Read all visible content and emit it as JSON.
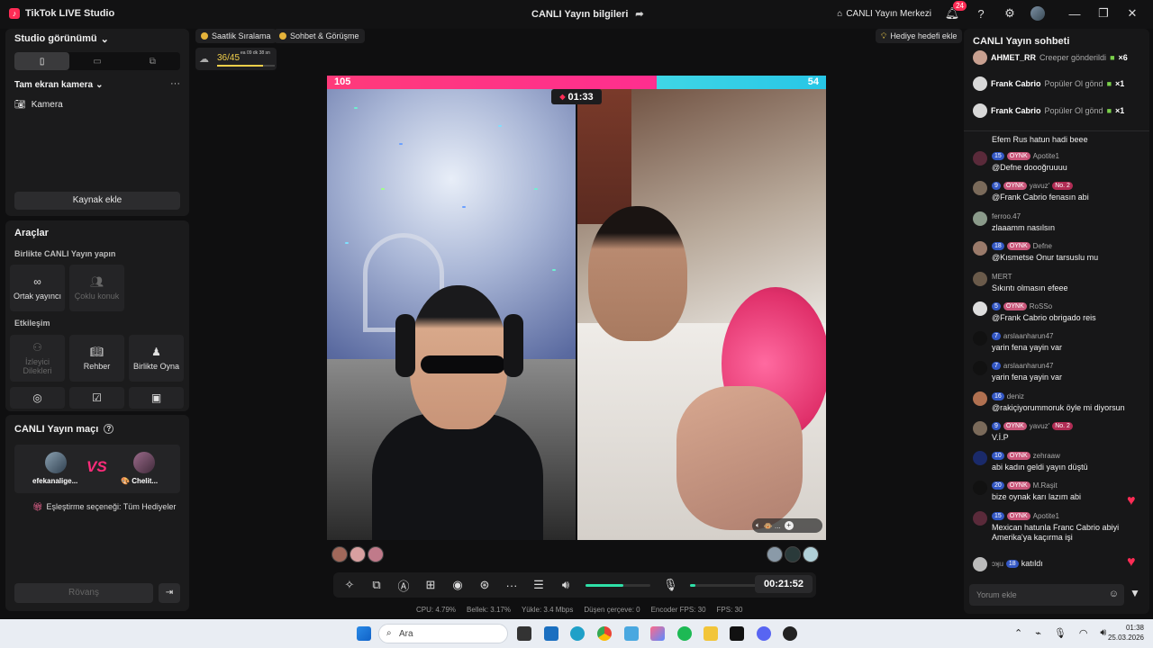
{
  "titlebar": {
    "app_name": "TikTok LIVE Studio",
    "live_info": "CANLI Yayın bilgileri",
    "live_center": "CANLI Yayın Merkezi",
    "notif_count": "24"
  },
  "left": {
    "studio_view": "Studio görünümü",
    "fullscreen_camera": "Tam ekran kamera",
    "camera": "Kamera",
    "add_source": "Kaynak ekle",
    "tools": "Araçlar",
    "live_together": "Birlikte CANLI Yayın yapın",
    "cohost": "Ortak yayıncı",
    "multi_guest": "Çoklu konuk",
    "interaction": "Etkileşim",
    "viewer_wishes": "İzleyici Dilekleri",
    "guide": "Rehber",
    "play_together": "Birlikte Oyna",
    "match_title": "CANLI Yayın maçı",
    "player1": "efekanalige...",
    "player2": "Chelit...",
    "vs": "VS",
    "match_option": "Eşleştirme seçeneği: Tüm Hediyeler",
    "rematch": "Rövanş"
  },
  "center": {
    "hourly_ranking": "Saatlik Sıralama",
    "chat_meet": "Sohbet & Görüşme",
    "goal_add": "Hediye hedefi ekle",
    "progress_text": "36/45",
    "progress_value": 0.8,
    "progress_sub": "ea 09 dk 38 sn",
    "score_left": "105",
    "score_right": "54",
    "battle_timer": "01:33",
    "live_time": "00:21:52"
  },
  "stats": {
    "cpu": "CPU: 4.79%",
    "memory": "Bellek: 3.17%",
    "upload": "Yükle: 3.4 Mbps",
    "dropped": "Düşen çerçeve: 0",
    "encoder_fps": "Encoder FPS: 30",
    "fps": "FPS: 30"
  },
  "chat": {
    "title": "CANLI Yayın sohbeti",
    "input_placeholder": "Yorum ekle",
    "gifts": [
      {
        "user": "AHMET_RR",
        "text": "Creeper gönderildi",
        "count": "×6"
      },
      {
        "user": "Frank Cabrio",
        "text": "Popüler Ol gönd",
        "count": "×1"
      },
      {
        "user": "Frank Cabrio",
        "text": "Popüler Ol gönd",
        "count": "×1"
      }
    ],
    "first_line": "Efem Rus hatun hadi beee",
    "messages": [
      {
        "lvl": "15",
        "tag": "OYNK",
        "user": "Apotite1",
        "text": "@Defne doooğruuuu",
        "color": "#5a2a3a"
      },
      {
        "lvl": "9",
        "tag": "OYNK",
        "user": "yavuz'",
        "extra": "No. 2",
        "text": "@Frank Cabrio fenasın abi",
        "color": "#7a6a5a"
      },
      {
        "lvl": "",
        "tag": "",
        "user": "ferroo.47",
        "text": "zlaaamm nasılsın",
        "color": "#8a9a8a"
      },
      {
        "lvl": "18",
        "tag": "OYNK",
        "user": "Defne",
        "text": "@Kısmetse Onur tarsuslu mu",
        "color": "#9a7a6a"
      },
      {
        "lvl": "",
        "tag": "",
        "user": "MERT",
        "text": "Sıkıntı olmasın efeee",
        "color": "#6a5a4a"
      },
      {
        "lvl": "5",
        "tag": "OYNK",
        "user": "RoSSo",
        "text": "@Frank Cabrio obrigado reis",
        "color": "#ddd"
      },
      {
        "lvl": "7",
        "tag": "",
        "user": "arslaanharun47",
        "text": "yarin fena yayin var",
        "color": "#111"
      },
      {
        "lvl": "7",
        "tag": "",
        "user": "arslaanharun47",
        "text": "yarin fena yayin var",
        "color": "#111"
      },
      {
        "lvl": "16",
        "tag": "",
        "user": "deniz",
        "text": "@rakiçiyorummoruk öyle mi diyorsun",
        "color": "#b07050"
      },
      {
        "lvl": "9",
        "tag": "OYNK",
        "user": "yavuz'",
        "extra": "No. 2",
        "text": "V.İ.P",
        "color": "#7a6a5a"
      },
      {
        "lvl": "10",
        "tag": "OYNK",
        "user": "zehraaw",
        "text": "abi kadın geldi yayın düştü",
        "color": "#1a2a6a"
      },
      {
        "lvl": "20",
        "tag": "OYNK",
        "user": "M.Raşit",
        "text": "bize oynak karı lazım abi",
        "color": "#111"
      },
      {
        "lvl": "15",
        "tag": "OYNK",
        "user": "Apotite1",
        "text": "Mexican hatunla Franc Cabrio abiyi",
        "text2": "Amerika'ya kaçırma işi",
        "color": "#5a2a3a"
      }
    ],
    "join_user": "ɔʞıɹ",
    "join_lvl": "18",
    "join_text": "katıldı"
  },
  "taskbar": {
    "search": "Ara",
    "time": "01:38",
    "date": "25.03.2026"
  }
}
